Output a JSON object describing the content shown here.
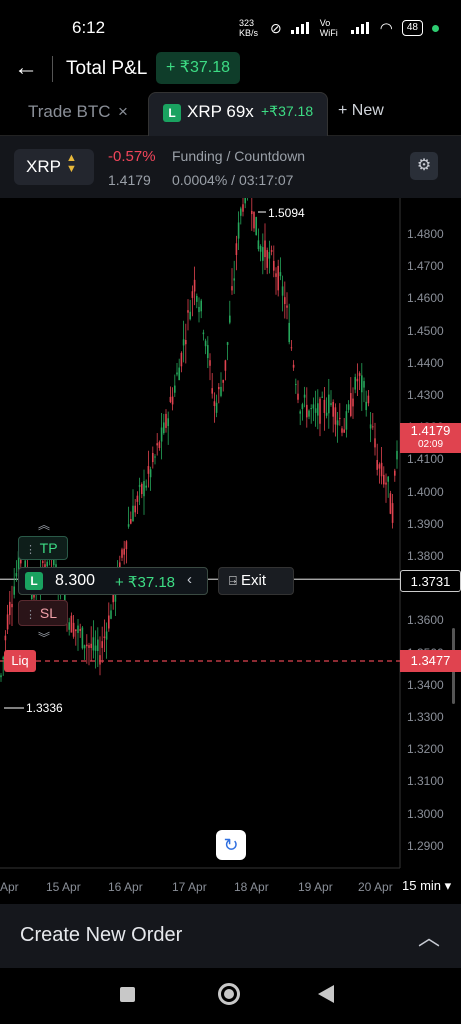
{
  "status_bar": {
    "time": "6:12",
    "net_speed": "323 KB/s",
    "network": "Vo WiFi",
    "battery": "48"
  },
  "header": {
    "title": "Total P&L",
    "pnl": "+ ₹37.18"
  },
  "tabs": {
    "tab1_label": "Trade BTC",
    "tab1_close": "×",
    "tab2_badge": "L",
    "tab2_label": "XRP 69x",
    "tab2_pnl": "+₹37.18",
    "new_label": "+ New"
  },
  "info": {
    "symbol": "XRP",
    "change": "-0.57%",
    "price": "1.4179",
    "funding_label": "Funding / Countdown",
    "funding_value": "0.0004% / 03:17:07"
  },
  "chart": {
    "high_label": "1.5094",
    "low_label": "1.3336",
    "y_ticks": [
      "1.4800",
      "1.4700",
      "1.4600",
      "1.4500",
      "1.4400",
      "1.4300",
      "1.4200",
      "1.4100",
      "1.4000",
      "1.3900",
      "1.3800",
      "1.3700",
      "1.3600",
      "1.3500",
      "1.3400",
      "1.3300",
      "1.3200",
      "1.3100",
      "1.3000",
      "1.2900"
    ],
    "x_ticks": [
      "Apr",
      "15 Apr",
      "16 Apr",
      "17 Apr",
      "18 Apr",
      "19 Apr",
      "20 Apr"
    ],
    "last_price": "1.4179",
    "last_countdown": "02:09",
    "entry_price": "1.3731",
    "liq_price": "1.3477",
    "liq_label": "Liq",
    "interval": "15 min ▾"
  },
  "position": {
    "side_badge": "L",
    "size": "8.300",
    "pnl": "+ ₹37.18",
    "exit_label": "Exit",
    "tp_label": "TP",
    "sl_label": "SL"
  },
  "bottom": {
    "create_order_label": "Create New Order"
  },
  "colors": {
    "up": "#26a65b",
    "down": "#e0434f",
    "accent_green": "#3ddc84"
  }
}
